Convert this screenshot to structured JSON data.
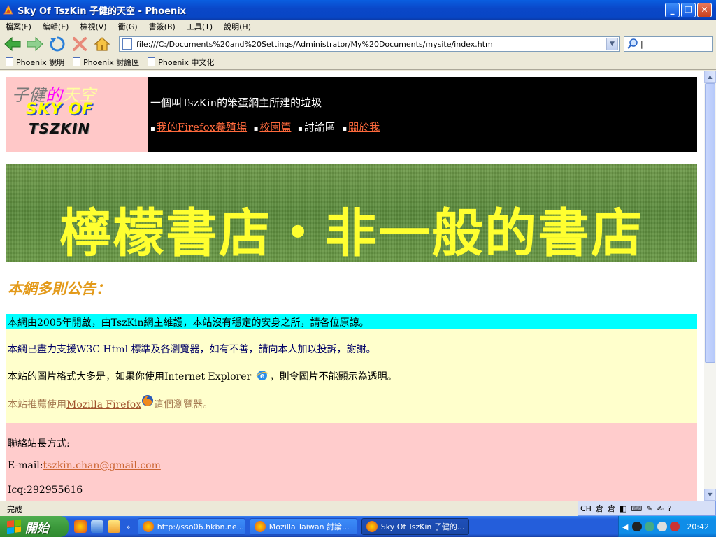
{
  "window": {
    "title": "Sky Of TszKin 子健的天空 - Phoenix",
    "minimize": "_",
    "maximize": "❐",
    "close": "✕"
  },
  "menu": [
    "檔案(F)",
    "編輯(E)",
    "檢視(V)",
    "衝(G)",
    "書簽(B)",
    "工具(T)",
    "說明(H)"
  ],
  "navigation": {
    "url": "file:///C:/Documents%20and%20Settings/Administrator/My%20Documents/mysite/index.htm",
    "search_value": "|"
  },
  "bookmarks": [
    "Phoenix 說明",
    "Phoenix 討論區",
    "Phoenix 中文化"
  ],
  "page": {
    "logo": {
      "line1_a": "子健",
      "line1_b": "的",
      "line1_c": "天空",
      "line2": "SKY OF",
      "line3": "TSZKIN"
    },
    "tagline": "一個叫TszKin的笨蛋網主所建的垃圾",
    "nav": [
      {
        "label": "我的Firefox養殖場",
        "link": true
      },
      {
        "label": "校園篇",
        "link": true
      },
      {
        "label": "討論區",
        "link": false
      },
      {
        "label": "關於我",
        "link": true
      }
    ],
    "banner_text": "檸檬書店・非一般的書店",
    "notice_title": "本網多則公告：",
    "notice1": "本網由2005年開啟，由TszKin網主維護，本站沒有穩定的安身之所，請各位原諒。",
    "notice2": "本網已盡力支援W3C Html 標準及各瀏覽器，如有不善，請向本人加以投訴，謝謝。",
    "notice3_pre": "本站的圖片格式大多是，如果你使用Internet Explorer",
    "notice3_post": "，則令圖片不能顯示為透明。",
    "notice4_pre": "本站推薦使用",
    "notice4_link": "Mozilla Firefox",
    "notice4_post": "這個瀏覽器。",
    "contact_title": "聯絡站長方式:",
    "email_label": "E-mail:",
    "email": "tszkin.chan@gmail.com",
    "icq": "Icq:292955616"
  },
  "status": "完成",
  "langbar": {
    "lang": "CH"
  },
  "taskbar": {
    "start": "開始",
    "tasks": [
      {
        "label": "http://sso06.hkbn.ne...",
        "active": false
      },
      {
        "label": "Mozilla Taiwan 討論...",
        "active": false
      },
      {
        "label": "Sky Of TszKin 子健的...",
        "active": true
      }
    ],
    "clock": "20:42"
  },
  "colors": {
    "header_bg": "#000000",
    "logo_bg": "#ffc8c8",
    "link_orange": "#ff6a3c",
    "banner_text": "#ffff30",
    "notice_title": "#e39a1a",
    "cyan_row": "#00ffff",
    "yellow_block": "#ffffcc",
    "pink_block": "#ffcccc"
  }
}
